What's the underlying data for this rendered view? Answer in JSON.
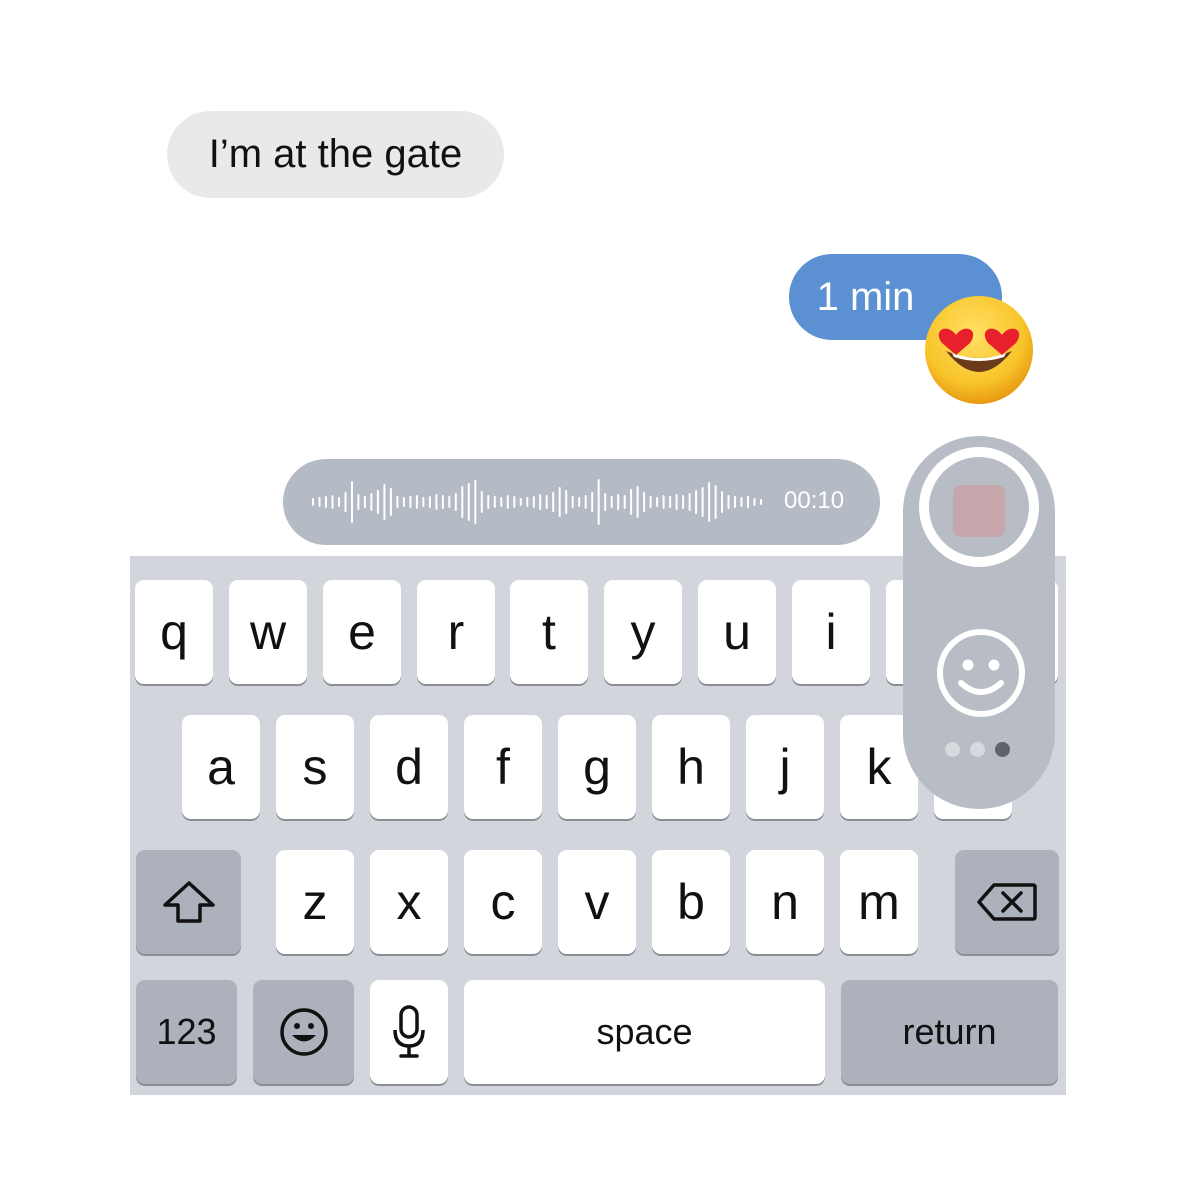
{
  "messages": {
    "incoming": "I’m at the gate",
    "outgoing": "1 min",
    "reaction": "smiling-face-with-heart-eyes"
  },
  "voice_recording": {
    "duration": "00:10"
  },
  "keyboard": {
    "row1": [
      "q",
      "w",
      "e",
      "r",
      "t",
      "y",
      "u",
      "i"
    ],
    "row2": [
      "a",
      "s",
      "d",
      "f",
      "g",
      "h",
      "j",
      "k"
    ],
    "row3": [
      "z",
      "x",
      "c",
      "v",
      "b",
      "n",
      "m"
    ],
    "numbers_key": "123",
    "space_key": "space",
    "return_key": "return",
    "icons": {
      "shift": "shift-icon",
      "delete": "delete-icon",
      "emoji": "emoji-icon",
      "mic": "microphone-icon"
    }
  },
  "recorder_panel": {
    "icons": [
      "stop-icon",
      "smiley-icon"
    ],
    "page_dots": 3,
    "active_dot": 3
  },
  "colors": {
    "incoming_bubble": "#e9e9eb",
    "outgoing_bubble": "#5b90d2",
    "keyboard_bg": "#d2d5db",
    "dark_key": "#acb1bb",
    "recorder_bg": "#b7bcc5",
    "stop_button": "#c6a5ab"
  }
}
